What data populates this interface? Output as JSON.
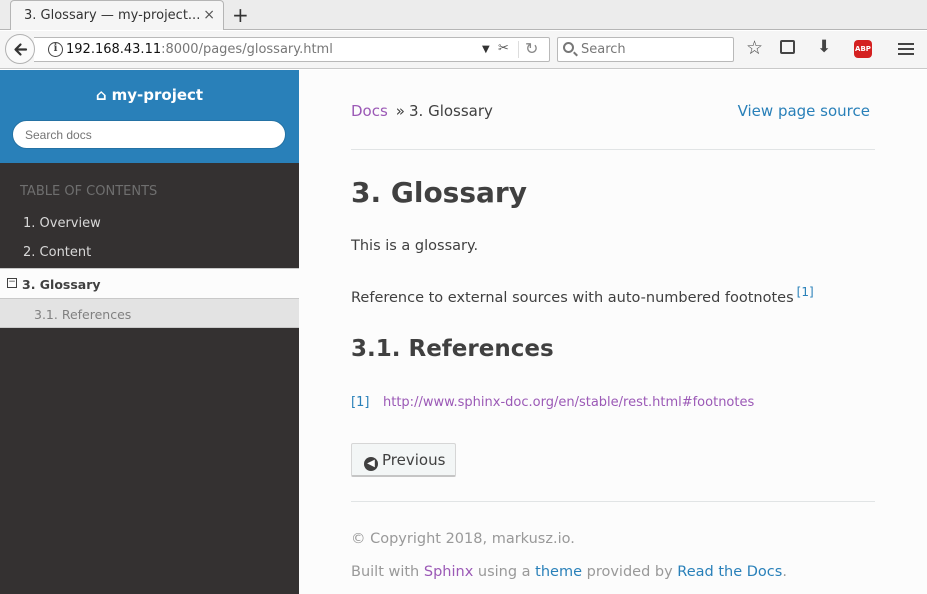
{
  "browser": {
    "tab_title": "3. Glossary — my-project...",
    "tab_close": "×",
    "new_tab": "+",
    "url_host": "192.168.43.11",
    "url_rest": ":8000/pages/glossary.html",
    "search_placeholder": "Search",
    "abp_label": "ABP"
  },
  "sidebar": {
    "project_name": "my-project",
    "search_placeholder": "Search docs",
    "toc_caption": "TABLE OF CONTENTS",
    "items": [
      {
        "label": "1. Overview"
      },
      {
        "label": "2. Content"
      },
      {
        "label": "3. Glossary"
      },
      {
        "label": "3.1. References"
      }
    ],
    "colors": {
      "header": "#2980b9",
      "background": "#343131"
    }
  },
  "content": {
    "breadcrumb_docs": "Docs",
    "breadcrumb_sep": "»",
    "breadcrumb_current": "3. Glossary",
    "view_source": "View page source",
    "title": "3. Glossary",
    "para1": "This is a glossary.",
    "para2": "Reference to external sources with auto-numbered footnotes",
    "footnote_ref": "[1]",
    "section_title": "3.1. References",
    "footnote_num": "[1]",
    "footnote_url": "http://www.sphinx-doc.org/en/stable/rest.html#footnotes",
    "prev_button": "Previous",
    "copyright": "© Copyright 2018, markusz.io.",
    "built_with": "Built with",
    "sphinx": "Sphinx",
    "using_a": "using a",
    "theme": "theme",
    "provided_by": "provided by",
    "rtd": "Read the Docs",
    "period": "."
  }
}
